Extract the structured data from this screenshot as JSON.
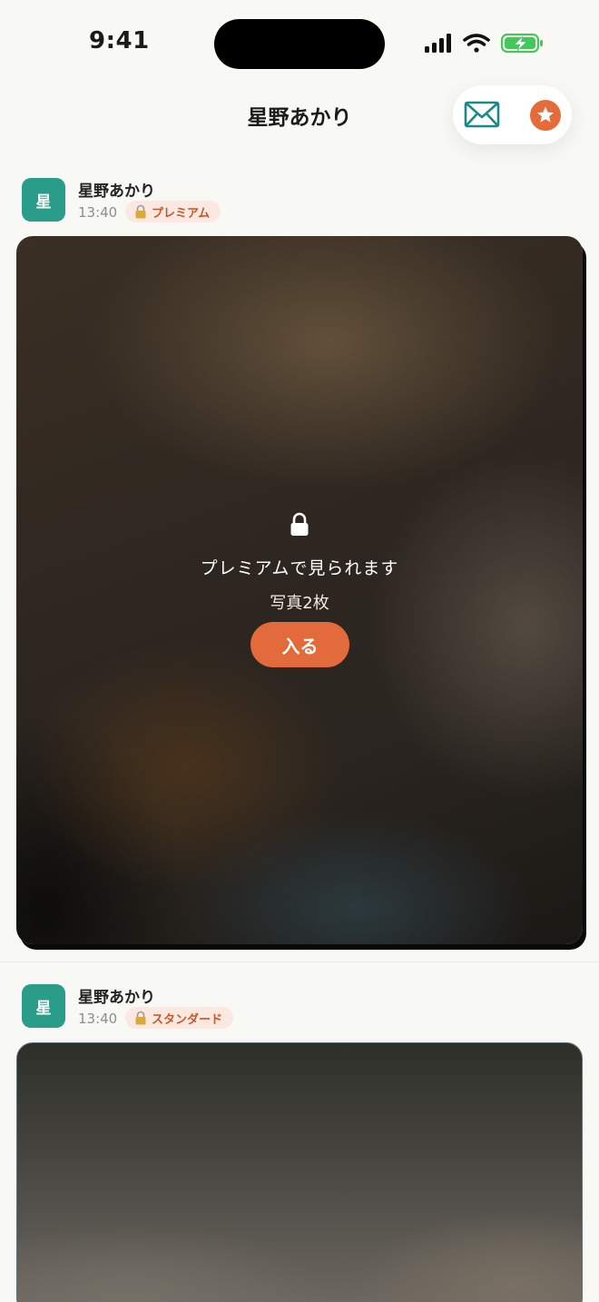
{
  "status_bar": {
    "time": "9:41"
  },
  "header": {
    "title": "星野あかり",
    "mail_icon": "envelope-icon",
    "star_icon": "star-icon",
    "accent_color": "#e56c3a"
  },
  "posts": [
    {
      "avatar_text": "星",
      "author": "星野あかり",
      "time": "13:40",
      "badge": "プレミアム",
      "locked": {
        "message": "プレミアムで見られます",
        "photo_count": "写真2枚",
        "button_label": "入る"
      }
    },
    {
      "avatar_text": "星",
      "author": "星野あかり",
      "time": "13:40",
      "badge": "スタンダード"
    }
  ]
}
